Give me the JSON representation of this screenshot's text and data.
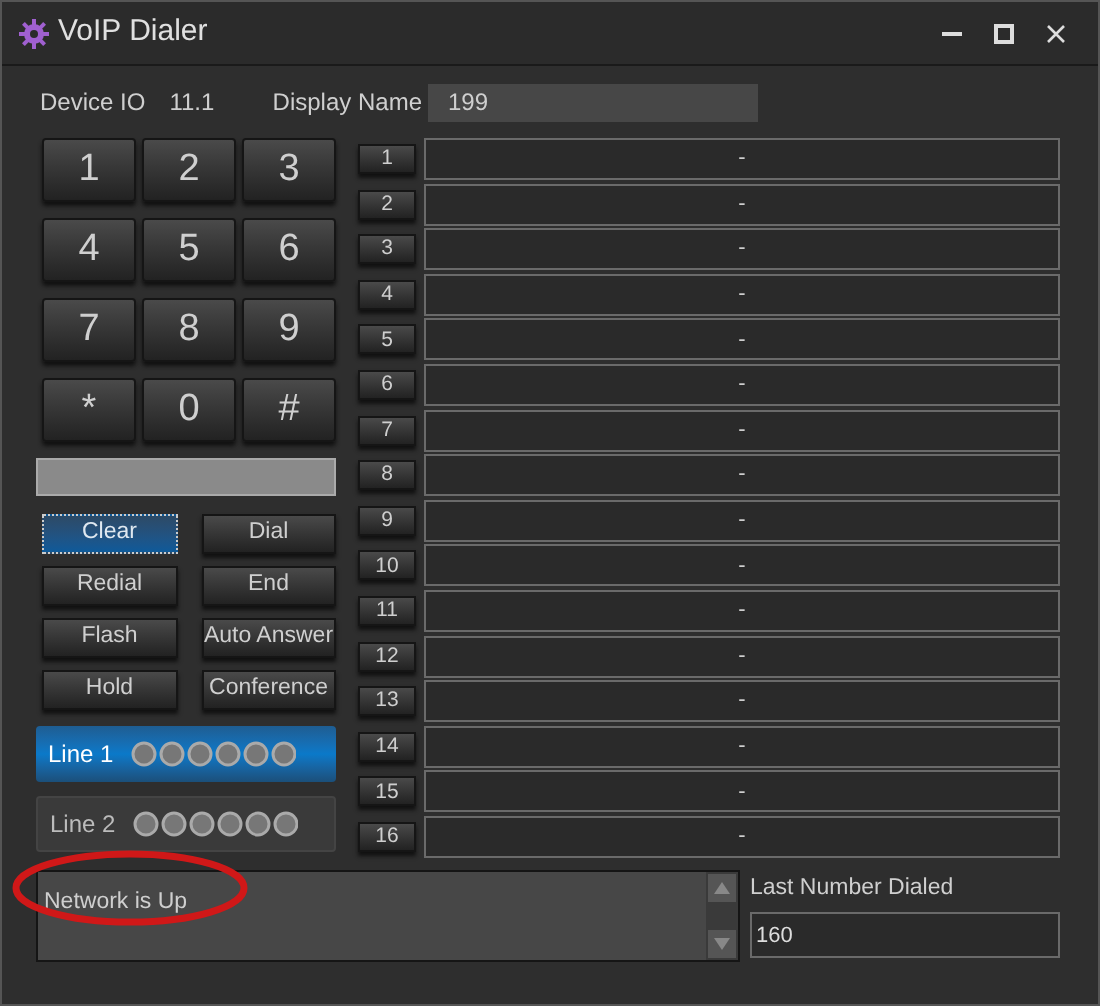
{
  "window": {
    "title": "VoIP Dialer"
  },
  "device": {
    "label": "Device IO",
    "value": "11.1"
  },
  "display_name": {
    "label": "Display Name",
    "value": "199"
  },
  "keypad": [
    "1",
    "2",
    "3",
    "4",
    "5",
    "6",
    "7",
    "8",
    "9",
    "*",
    "0",
    "#"
  ],
  "function_buttons": [
    {
      "label": "Clear",
      "focused": true
    },
    {
      "label": "Dial",
      "focused": false
    },
    {
      "label": "Redial",
      "focused": false
    },
    {
      "label": "End",
      "focused": false
    },
    {
      "label": "Flash",
      "focused": false
    },
    {
      "label": "Auto Answer",
      "focused": false
    },
    {
      "label": "Hold",
      "focused": false
    },
    {
      "label": "Conference",
      "focused": false
    }
  ],
  "lines": [
    {
      "label": "Line 1",
      "selected": true
    },
    {
      "label": "Line 2",
      "selected": false
    }
  ],
  "speed_dials": [
    {
      "number": "1",
      "value": "-"
    },
    {
      "number": "2",
      "value": "-"
    },
    {
      "number": "3",
      "value": "-"
    },
    {
      "number": "4",
      "value": "-"
    },
    {
      "number": "5",
      "value": "-"
    },
    {
      "number": "6",
      "value": "-"
    },
    {
      "number": "7",
      "value": "-"
    },
    {
      "number": "8",
      "value": "-"
    },
    {
      "number": "9",
      "value": "-"
    },
    {
      "number": "10",
      "value": "-"
    },
    {
      "number": "11",
      "value": "-"
    },
    {
      "number": "12",
      "value": "-"
    },
    {
      "number": "13",
      "value": "-"
    },
    {
      "number": "14",
      "value": "-"
    },
    {
      "number": "15",
      "value": "-"
    },
    {
      "number": "16",
      "value": "-"
    }
  ],
  "status": {
    "text": "Network is Up"
  },
  "last_number": {
    "label": "Last Number Dialed",
    "value": "160"
  }
}
